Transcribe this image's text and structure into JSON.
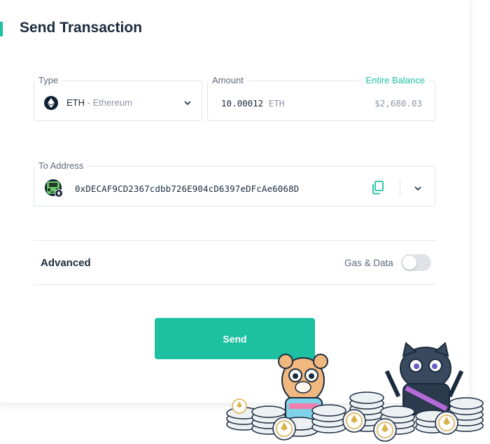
{
  "page": {
    "title": "Send Transaction"
  },
  "type_field": {
    "legend": "Type",
    "symbol": "ETH",
    "separator": " - ",
    "name": "Ethereum",
    "icon": "ethereum-icon"
  },
  "amount_field": {
    "legend": "Amount",
    "value": "10.00012",
    "unit": "ETH",
    "entire_balance": "Entire Balance",
    "fiat": "$2,680.03"
  },
  "to_field": {
    "legend": "To Address",
    "address": "0xDECAF9CD2367cdbb726E904cD6397eDFcAe6068D",
    "icons": [
      "identicon",
      "copy-icon",
      "chevron-down-icon"
    ]
  },
  "advanced": {
    "label": "Advanced",
    "toggle_label": "Gas & Data",
    "toggle_on": false
  },
  "send_button": {
    "label": "Send"
  },
  "colors": {
    "accent": "#1ec0a2",
    "text": "#1b2b3e",
    "muted": "#8a96a4",
    "border": "#e1e5ea"
  }
}
